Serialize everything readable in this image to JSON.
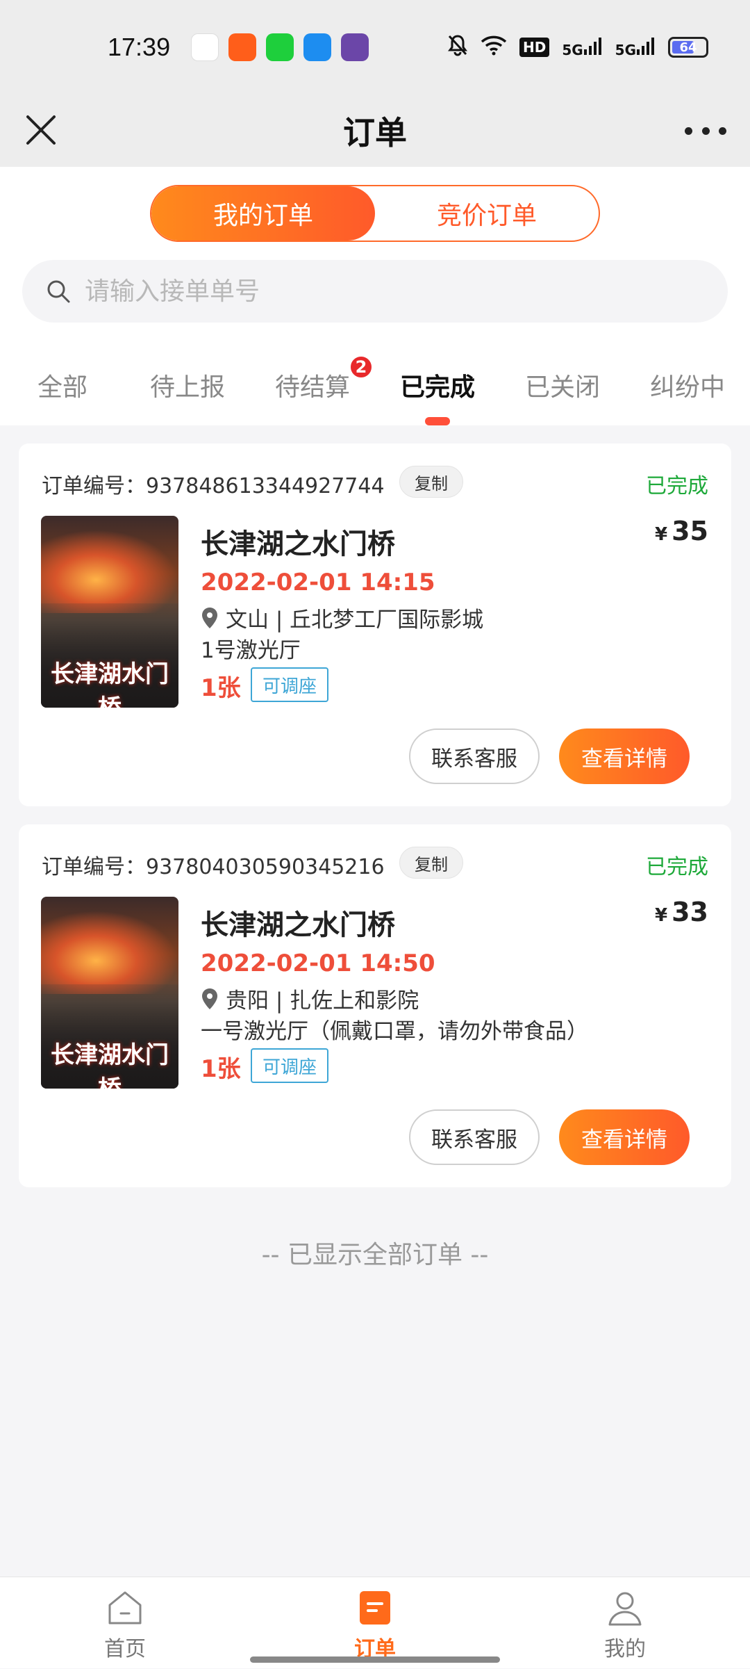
{
  "status_bar": {
    "time": "17:39",
    "hd_label": "HD",
    "signal1": "5G",
    "signal2": "5G",
    "battery": "64"
  },
  "header": {
    "title": "订单"
  },
  "segment": {
    "items": [
      "我的订单",
      "竞价订单"
    ],
    "active_index": 0
  },
  "search": {
    "placeholder": "请输入接单单号"
  },
  "tabs": {
    "items": [
      "全部",
      "待上报",
      "待结算",
      "已完成",
      "已关闭",
      "纠纷中"
    ],
    "active": "已完成",
    "badge_tab": "待结算",
    "badge_count": "2"
  },
  "orders": [
    {
      "order_no_label": "订单编号：937848613344927744",
      "copy_label": "复制",
      "status": "已完成",
      "title": "长津湖之水门桥",
      "currency": "¥",
      "price": "35",
      "showtime": "2022-02-01 14:15",
      "cinema": "文山 | 丘北梦工厂国际影城",
      "hall": "1号激光厅",
      "tickets": "1张",
      "seat_tag": "可调座",
      "contact_label": "联系客服",
      "detail_label": "查看详情",
      "poster_title": "长津湖水门桥"
    },
    {
      "order_no_label": "订单编号：937804030590345216",
      "copy_label": "复制",
      "status": "已完成",
      "title": "长津湖之水门桥",
      "currency": "¥",
      "price": "33",
      "showtime": "2022-02-01 14:50",
      "cinema": "贵阳 | 扎佐上和影院",
      "hall": "一号激光厅（佩戴口罩，请勿外带食品）",
      "tickets": "1张",
      "seat_tag": "可调座",
      "contact_label": "联系客服",
      "detail_label": "查看详情",
      "poster_title": "长津湖水门桥"
    }
  ],
  "end_note": "-- 已显示全部订单 --",
  "bottom_nav": {
    "items": [
      "首页",
      "订单",
      "我的"
    ],
    "active": "订单"
  },
  "colors": {
    "accent": "#ff6a2a",
    "price_red": "#ee4e3a",
    "status_green": "#1ea93a",
    "tag_blue": "#3ea6d6"
  }
}
